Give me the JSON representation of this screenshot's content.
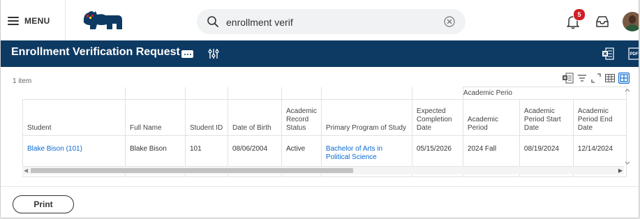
{
  "topbar": {
    "menu_label": "MENU",
    "search_value": "enrollment verif",
    "notification_count": "5"
  },
  "header": {
    "title": "Enrollment Verification Request"
  },
  "grid": {
    "item_count": "1 item",
    "group_header": "Academic Perio",
    "columns": [
      "Student",
      "Full Name",
      "Student ID",
      "Date of Birth",
      "Academic Record Status",
      "Primary Program of Study",
      "Expected Completion Date",
      "Academic Period",
      "Academic Period Start Date",
      "Academic Period End Date"
    ],
    "rows": [
      {
        "student": "Blake Bison (101)",
        "full_name": "Blake Bison",
        "student_id": "101",
        "date_of_birth": "08/06/2004",
        "record_status": "Active",
        "program": "Bachelor of Arts in Political Science",
        "expected_completion": "05/15/2026",
        "academic_period": "2024 Fall",
        "period_start": "08/19/2024",
        "period_end": "12/14/2024"
      }
    ]
  },
  "footer": {
    "print_label": "Print"
  },
  "colors": {
    "header_band": "#0d3a63",
    "link": "#0a6ad1",
    "badge": "#d11f26"
  }
}
